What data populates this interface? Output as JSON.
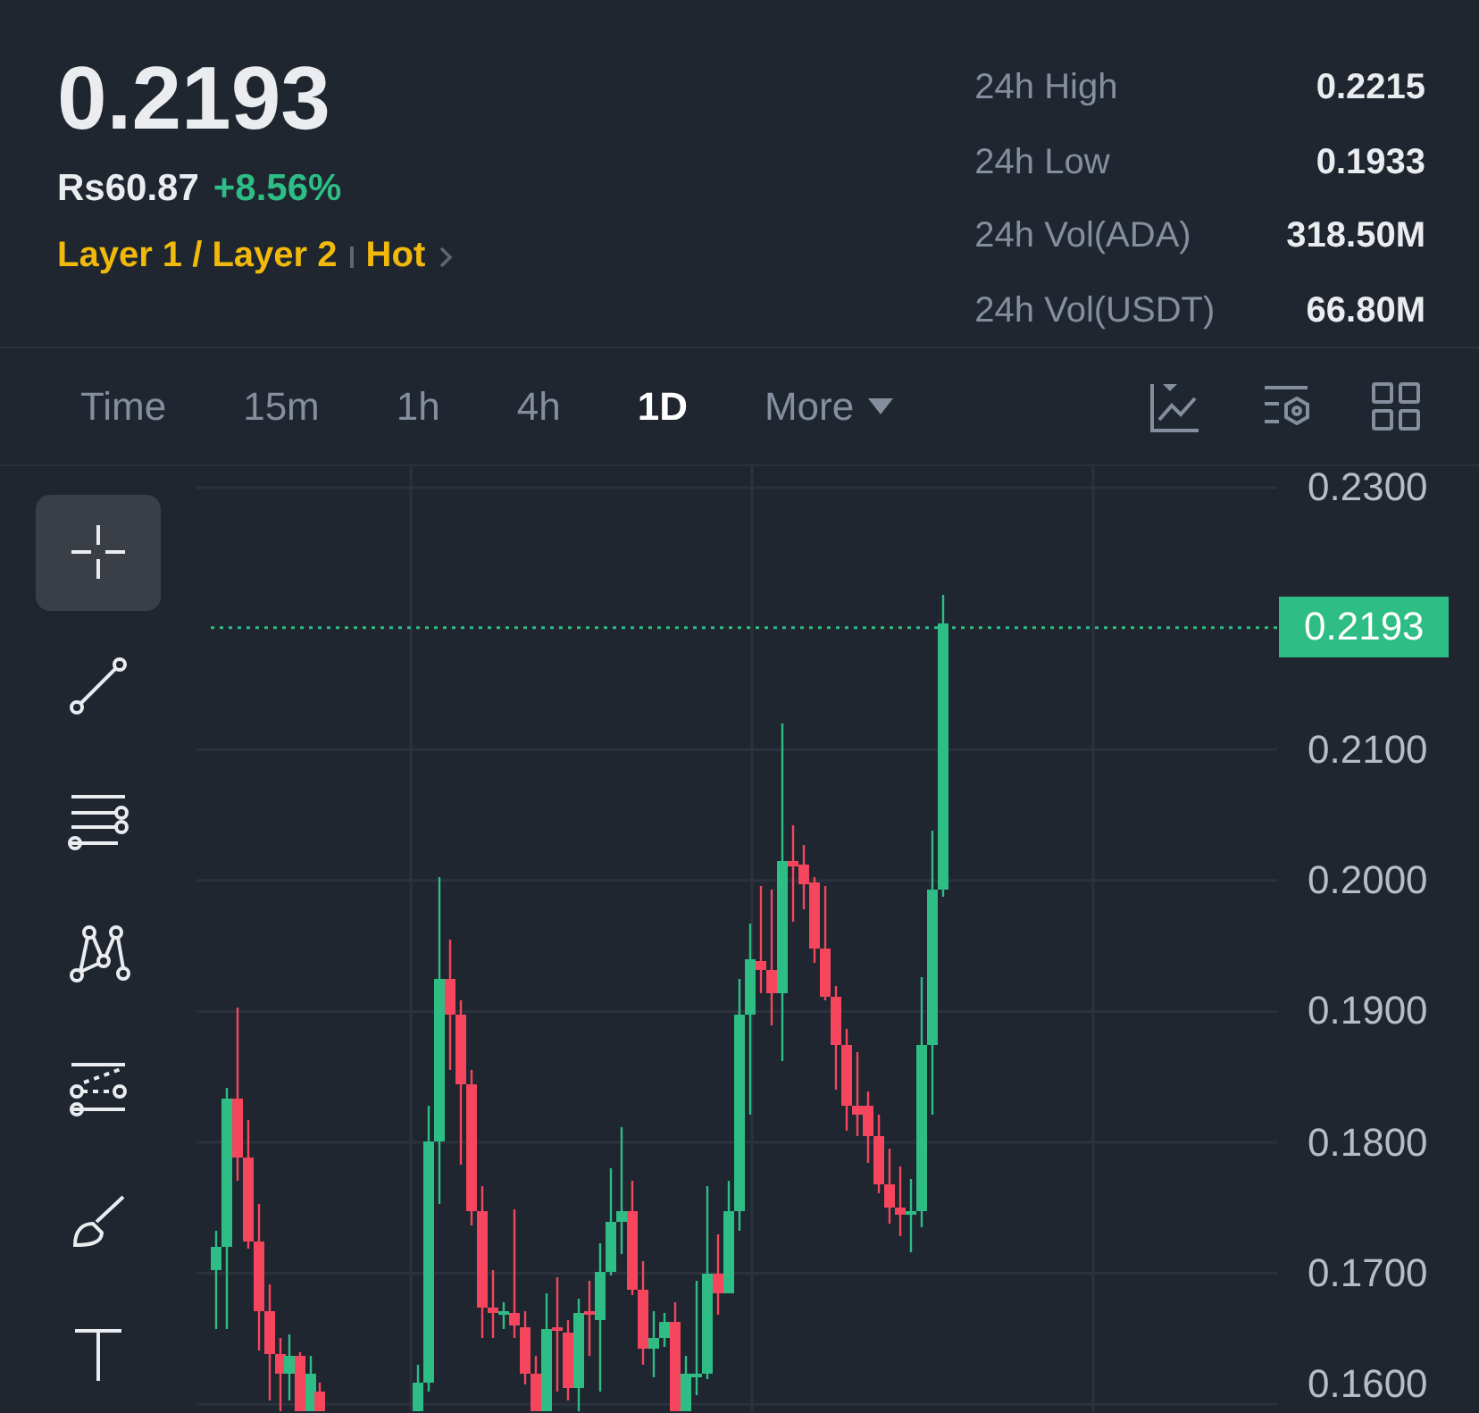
{
  "ticker": {
    "last_price": "0.2193",
    "fiat_price": "Rs60.87",
    "change": "+8.56%",
    "tags": [
      {
        "label": "Layer 1 / Layer 2"
      },
      {
        "label": "Hot"
      }
    ]
  },
  "stats": [
    {
      "label": "24h High",
      "value": "0.2215"
    },
    {
      "label": "24h Low",
      "value": "0.1933"
    },
    {
      "label": "24h Vol(ADA)",
      "value": "318.50M"
    },
    {
      "label": "24h Vol(USDT)",
      "value": "66.80M"
    }
  ],
  "intervals": [
    {
      "label": "Time",
      "kind": "option",
      "selected": false
    },
    {
      "label": "15m",
      "kind": "option",
      "selected": false
    },
    {
      "label": "1h",
      "kind": "option",
      "selected": false
    },
    {
      "label": "4h",
      "kind": "option",
      "selected": false
    },
    {
      "label": "1D",
      "kind": "option",
      "selected": true
    },
    {
      "label": "More",
      "kind": "menu",
      "selected": false
    }
  ],
  "drawing_tools": [
    {
      "kind": "crosshair",
      "selected": true
    },
    {
      "kind": "line",
      "selected": false
    },
    {
      "kind": "hlines",
      "selected": false
    },
    {
      "kind": "pattern",
      "selected": false
    },
    {
      "kind": "channel",
      "selected": false
    },
    {
      "kind": "brush",
      "selected": false
    },
    {
      "kind": "text",
      "selected": false
    }
  ],
  "chart": {
    "price_axis": [
      "0.2300",
      "0.2100",
      "0.2000",
      "0.1900",
      "0.1800",
      "0.1700",
      "0.1600"
    ],
    "current_price": "0.2193"
  }
}
